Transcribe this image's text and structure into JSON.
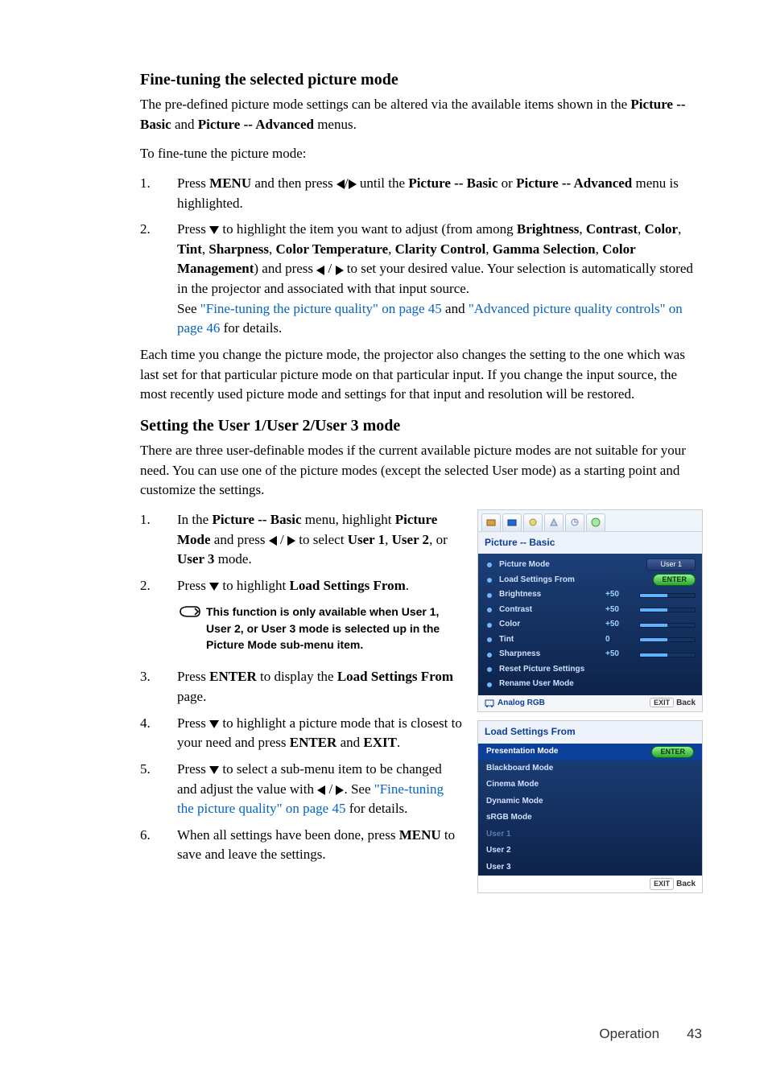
{
  "section1": {
    "heading": "Fine-tuning the selected picture mode",
    "intro_a": "The pre-defined picture mode settings can be altered via the available items shown in the ",
    "intro_b1": "Picture -- Basic",
    "intro_mid": " and ",
    "intro_b2": "Picture -- Advanced",
    "intro_c": " menus.",
    "line2": "To fine-tune the picture mode:",
    "step1_a": "Press ",
    "step1_menu": "MENU",
    "step1_b": " and then press ",
    "step1_c": " until the ",
    "step1_pb": "Picture -- Basic",
    "step1_or": " or ",
    "step1_pa": "Picture -- Advanced",
    "step1_d": " menu is highlighted.",
    "step2_a": "Press ",
    "step2_b": " to highlight the item you want to adjust (from among ",
    "items": [
      "Brightness",
      "Contrast",
      "Color",
      "Tint",
      "Sharpness",
      "Color Temperature",
      "Clarity Control",
      "Gamma Selection",
      "Color Management"
    ],
    "step2_c": ") and press ",
    "step2_d": " to set your desired value. Your selection is automatically stored in the projector and associated with that input source.",
    "see": "See ",
    "link1": "\"Fine-tuning the picture quality\" on page 45",
    "and": " and ",
    "link2": "\"Advanced picture quality controls\" on page 46",
    "details": " for details.",
    "closing": "Each time you change the picture mode, the projector also changes the setting to the one which was last set for that particular picture mode on that particular input. If you change the input source, the most recently used picture mode and settings for that input and resolution will be restored."
  },
  "section2": {
    "heading": "Setting the User 1/User 2/User 3 mode",
    "intro": "There are three user-definable modes if the current available picture modes are not suitable for your need. You can use one of the picture modes (except the selected User mode) as a starting point and customize the settings.",
    "s1_a": "In the ",
    "s1_pb": "Picture -- Basic",
    "s1_b": " menu, highlight ",
    "s1_pm": "Picture Mode",
    "s1_c": " and press ",
    "s1_d": " to select ",
    "s1_u1": "User 1",
    "s1_com": ", ",
    "s1_u2": "User 2",
    "s1_or": ", or ",
    "s1_u3": "User 3",
    "s1_e": " mode.",
    "s2_a": "Press ",
    "s2_b": " to highlight ",
    "s2_ls": "Load Settings From",
    "s2_c": ".",
    "note": "This function is only available when User 1, User 2, or User 3 mode is selected up in the Picture Mode sub-menu item.",
    "s3_a": "Press ",
    "s3_enter": "ENTER",
    "s3_b": " to display the ",
    "s3_ls": "Load Settings From",
    "s3_c": " page.",
    "s4_a": "Press ",
    "s4_b": " to highlight a picture mode that is closest to your need and press ",
    "s4_enter": "ENTER",
    "s4_and": " and ",
    "s4_exit": "EXIT",
    "s4_c": ".",
    "s5_a": "Press ",
    "s5_b": " to select a sub-menu item to be changed and adjust the value with ",
    "s5_c": ". See ",
    "s5_link": "\"Fine-tuning the picture quality\" on page 45",
    "s5_d": " for details.",
    "s6_a": "When all settings have been done, press ",
    "s6_menu": "MENU",
    "s6_b": " to save and leave the settings."
  },
  "osd1": {
    "title": "Picture -- Basic",
    "rows": [
      {
        "label": "Picture Mode",
        "val": "",
        "badge": "User 1"
      },
      {
        "label": "Load Settings From",
        "val": "",
        "badge": "ENTER",
        "enter": true
      },
      {
        "label": "Brightness",
        "val": "+50",
        "slider": true
      },
      {
        "label": "Contrast",
        "val": "+50",
        "slider": true
      },
      {
        "label": "Color",
        "val": "+50",
        "slider": true
      },
      {
        "label": "Tint",
        "val": "0",
        "slider": true
      },
      {
        "label": "Sharpness",
        "val": "+50",
        "slider": true
      },
      {
        "label": "Reset Picture Settings",
        "val": ""
      },
      {
        "label": "Rename User Mode",
        "val": ""
      }
    ],
    "foot_left": "Analog RGB",
    "foot_exit": "EXIT",
    "foot_back": "Back"
  },
  "osd2": {
    "title": "Load Settings From",
    "items": [
      {
        "t": "Presentation Mode",
        "sel": true,
        "enter": "ENTER"
      },
      {
        "t": "Blackboard Mode"
      },
      {
        "t": "Cinema Mode"
      },
      {
        "t": "Dynamic Mode"
      },
      {
        "t": "sRGB Mode"
      },
      {
        "t": "User 1",
        "dim": true
      },
      {
        "t": "User 2"
      },
      {
        "t": "User 3"
      }
    ],
    "foot_exit": "EXIT",
    "foot_back": "Back"
  },
  "footer": {
    "section": "Operation",
    "page": "43"
  }
}
